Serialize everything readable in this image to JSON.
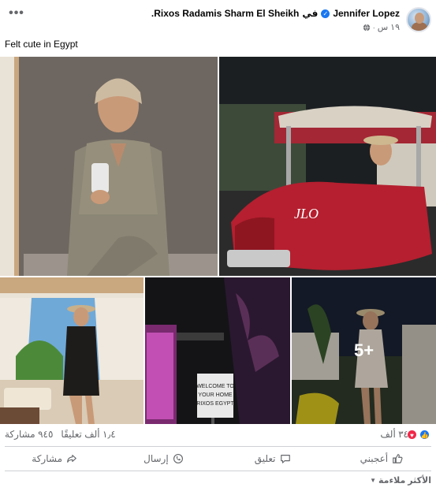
{
  "post": {
    "author": "Jennifer Lopez",
    "location_prefix": "في",
    "location": "Rixos Radamis Sharm El Sheikh.",
    "time": "١٩ س",
    "caption": "Felt cute in Egypt",
    "more_photos": "5+"
  },
  "counts": {
    "reactions": "٣٤ ألف",
    "comments": "١٫٤ ألف تعليقًا",
    "shares": "٩٤٥ مشاركة"
  },
  "actions": {
    "like": "أعجبني",
    "comment": "تعليق",
    "send": "إرسال",
    "share": "مشاركة"
  },
  "sort": {
    "label": "الأكثر ملاءمة"
  },
  "colors": {
    "accent": "#1877f2",
    "love": "#f02849",
    "secondary_text": "#65676b"
  },
  "icons": [
    "verified-icon",
    "globe-icon",
    "more-icon",
    "like-icon",
    "comment-icon",
    "send-icon",
    "share-icon",
    "caret-down-icon"
  ]
}
